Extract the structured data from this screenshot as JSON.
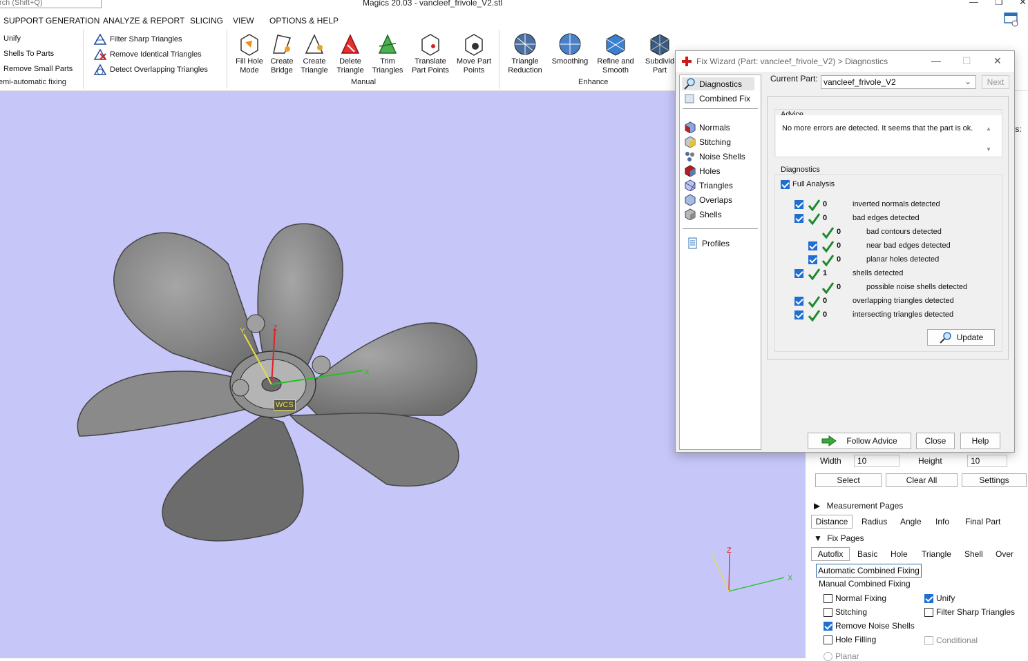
{
  "app": {
    "title": "Magics 20.03 - vancleef_frivole_V2.stl",
    "search_placeholder": "rch (Shift+Q)"
  },
  "menu": [
    "SUPPORT GENERATION",
    "ANALYZE & REPORT",
    "SLICING",
    "VIEW",
    "OPTIONS & HELP"
  ],
  "ribbon": {
    "semi_auto": [
      "Unify",
      "Shells To Parts",
      "Remove Small Parts"
    ],
    "semi_auto_label": "emi-automatic fixing",
    "triangles": [
      "Filter Sharp Triangles",
      "Remove Identical Triangles",
      "Detect Overlapping Triangles"
    ],
    "manual": [
      {
        "l1": "Fill Hole",
        "l2": "Mode"
      },
      {
        "l1": "Create",
        "l2": "Bridge"
      },
      {
        "l1": "Create",
        "l2": "Triangle"
      },
      {
        "l1": "Delete",
        "l2": "Triangle"
      },
      {
        "l1": "Trim",
        "l2": "Triangles"
      },
      {
        "l1": "Translate",
        "l2": "Part Points"
      },
      {
        "l1": "Move Part",
        "l2": "Points"
      }
    ],
    "manual_label": "Manual",
    "enhance": [
      {
        "l1": "Triangle",
        "l2": "Reduction"
      },
      {
        "l1": "Smoothing",
        "l2": ""
      },
      {
        "l1": "Refine and",
        "l2": "Smooth"
      },
      {
        "l1": "Subdivid",
        "l2": "Part"
      }
    ],
    "enhance_label": "Enhance"
  },
  "viewport": {
    "wcs_label": "WCS",
    "axis_x": "X",
    "axis_y": "Y",
    "axis_z": "Z"
  },
  "dialog": {
    "title": "Fix Wizard (Part: vancleef_frivole_V2) > Diagnostics",
    "nav": [
      "Diagnostics",
      "Combined Fix",
      "Normals",
      "Stitching",
      "Noise Shells",
      "Holes",
      "Triangles",
      "Overlaps",
      "Shells",
      "Profiles"
    ],
    "current_part_label": "Current Part:",
    "current_part_value": "vancleef_frivole_V2",
    "next_label": "Next",
    "advice_title": "Advice",
    "advice_text": "No more errors are detected. It seems that the part is ok.",
    "diagnostics_title": "Diagnostics",
    "full_analysis": "Full Analysis",
    "rows": [
      {
        "count": "0",
        "label": "inverted normals detected",
        "indent": 0,
        "checkbox": true
      },
      {
        "count": "0",
        "label": "bad edges detected",
        "indent": 0,
        "checkbox": true
      },
      {
        "count": "0",
        "label": "bad contours detected",
        "indent": 1,
        "checkbox": false
      },
      {
        "count": "0",
        "label": "near bad edges detected",
        "indent": 1,
        "checkbox": true
      },
      {
        "count": "0",
        "label": "planar holes detected",
        "indent": 1,
        "checkbox": true
      },
      {
        "count": "1",
        "label": "shells detected",
        "indent": 0,
        "checkbox": true
      },
      {
        "count": "0",
        "label": "possible noise shells detected",
        "indent": 1,
        "checkbox": false
      },
      {
        "count": "0",
        "label": "overlapping triangles detected",
        "indent": 0,
        "checkbox": true
      },
      {
        "count": "0",
        "label": "intersecting triangles detected",
        "indent": 0,
        "checkbox": true
      }
    ],
    "update_label": "Update",
    "follow_advice_label": "Follow Advice",
    "close_label": "Close",
    "help_label": "Help"
  },
  "panel": {
    "parts_fragment": "rts:",
    "width_label": "Width",
    "width_value": "10",
    "height_label": "Height",
    "height_value": "10",
    "select_label": "Select",
    "clear_all_label": "Clear All",
    "settings_label": "Settings",
    "measurement_pages": "Measurement Pages",
    "measure_tabs": [
      "Distance",
      "Radius",
      "Angle",
      "Info",
      "Final Part"
    ],
    "fix_pages": "Fix Pages",
    "fix_tabs": [
      "Autofix",
      "Basic",
      "Hole",
      "Triangle",
      "Shell",
      "Over"
    ],
    "auto_combined": "Automatic Combined Fixing",
    "manual_combined": "Manual Combined Fixing",
    "options": [
      {
        "label": "Normal Fixing",
        "checked": false
      },
      {
        "label": "Unify",
        "checked": true
      },
      {
        "label": "Stitching",
        "checked": false
      },
      {
        "label": "Filter Sharp Triangles",
        "checked": false
      },
      {
        "label": "Remove Noise Shells",
        "checked": true
      },
      {
        "label": "Hole Filling",
        "checked": false
      },
      {
        "label": "Conditional",
        "checked": false
      },
      {
        "label": "Planar",
        "checked": false
      }
    ]
  },
  "colors": {
    "viewport_bg": "#c6c6f8",
    "check_green": "#1e8a2e",
    "checkbox_blue": "#1f6fd1",
    "axis_x": "#22c322",
    "axis_y": "#e8e043",
    "axis_z": "#e02020"
  }
}
